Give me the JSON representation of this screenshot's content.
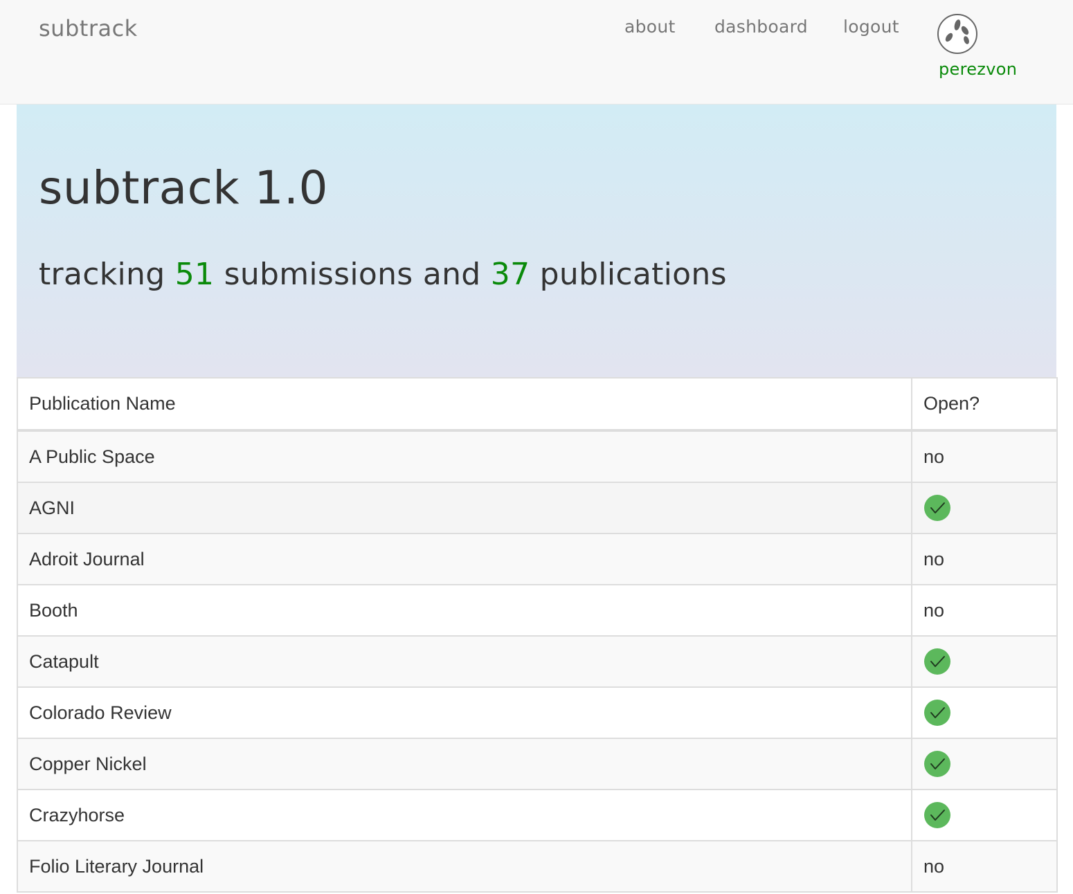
{
  "navbar": {
    "brand": "subtrack",
    "links": [
      "about",
      "dashboard",
      "logout"
    ],
    "username": "perezvon",
    "avatar_icon": "avatar-icon"
  },
  "hero": {
    "title": "subtrack 1.0",
    "subtitle_prefix": "tracking ",
    "submission_count": "51",
    "subtitle_middle": " submissions and ",
    "publication_count": "37",
    "subtitle_suffix": " publications"
  },
  "table": {
    "headers": [
      "Publication Name",
      "Open?"
    ],
    "rows": [
      {
        "name": "A Public Space",
        "open": false,
        "open_text": "no"
      },
      {
        "name": "AGNI",
        "open": true,
        "open_text": ""
      },
      {
        "name": "Adroit Journal",
        "open": false,
        "open_text": "no"
      },
      {
        "name": "Booth",
        "open": false,
        "open_text": "no"
      },
      {
        "name": "Catapult",
        "open": true,
        "open_text": ""
      },
      {
        "name": "Colorado Review",
        "open": true,
        "open_text": ""
      },
      {
        "name": "Copper Nickel",
        "open": true,
        "open_text": ""
      },
      {
        "name": "Crazyhorse",
        "open": true,
        "open_text": ""
      },
      {
        "name": "Folio Literary Journal",
        "open": false,
        "open_text": "no"
      }
    ]
  },
  "colors": {
    "accent_green": "#0a8a0a",
    "check_green": "#5cb85c",
    "navbar_bg": "#f8f8f8",
    "hero_top": "#d2ecf5",
    "hero_bottom": "#e2e4f0"
  },
  "icons": {
    "open_yes": "checkmark-circle-icon"
  }
}
